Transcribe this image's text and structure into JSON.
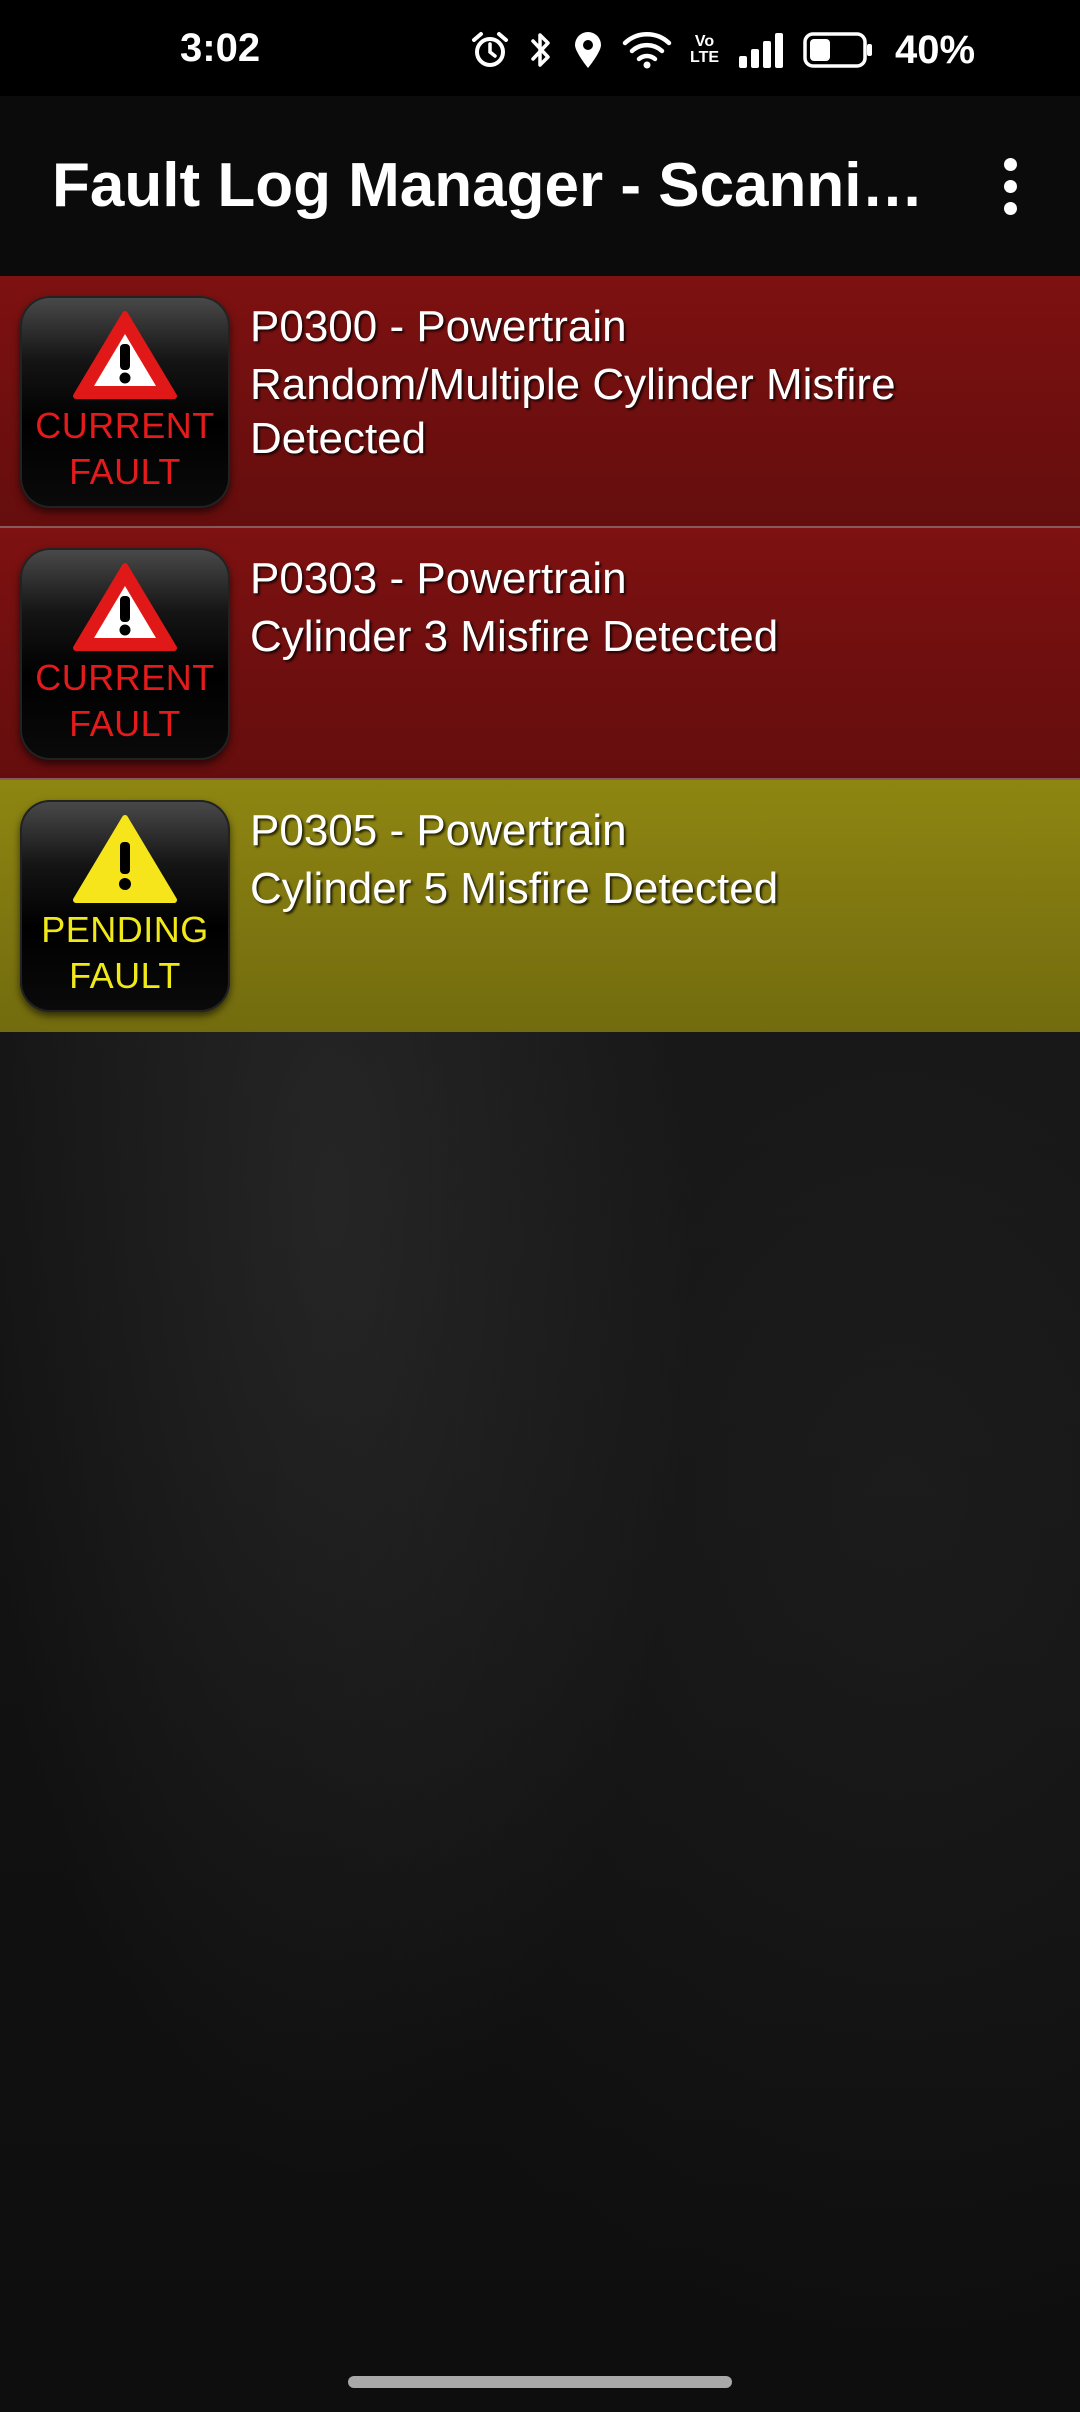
{
  "status_bar": {
    "time": "3:02",
    "volte_line1": "Vo",
    "volte_line2": "LTE",
    "battery_percent": "40%",
    "battery_level": 0.4,
    "icons": [
      "alarm-icon",
      "bluetooth-icon",
      "location-icon",
      "wifi-icon",
      "volte-icon",
      "signal-icon",
      "battery-icon"
    ]
  },
  "app_bar": {
    "title": "Fault Log Manager - Scanning",
    "menu_icon": "more-vert-icon"
  },
  "faults": [
    {
      "status": "current",
      "badge_line1": "CURRENT",
      "badge_line2": "FAULT",
      "code": "P0300 - Powertrain",
      "description": "Random/Multiple Cylinder Misfire Detected"
    },
    {
      "status": "current",
      "badge_line1": "CURRENT",
      "badge_line2": "FAULT",
      "code": "P0303 - Powertrain",
      "description": "Cylinder 3 Misfire Detected"
    },
    {
      "status": "pending",
      "badge_line1": "PENDING",
      "badge_line2": "FAULT",
      "code": "P0305 - Powertrain",
      "description": "Cylinder 5 Misfire Detected"
    }
  ],
  "colors": {
    "current_row": "#7a1111",
    "pending_row": "#8a8210",
    "current_badge_text": "#e31b1b",
    "pending_badge_text": "#f1e81a",
    "current_triangle": "#e01818",
    "pending_triangle": "#f5e51a"
  }
}
